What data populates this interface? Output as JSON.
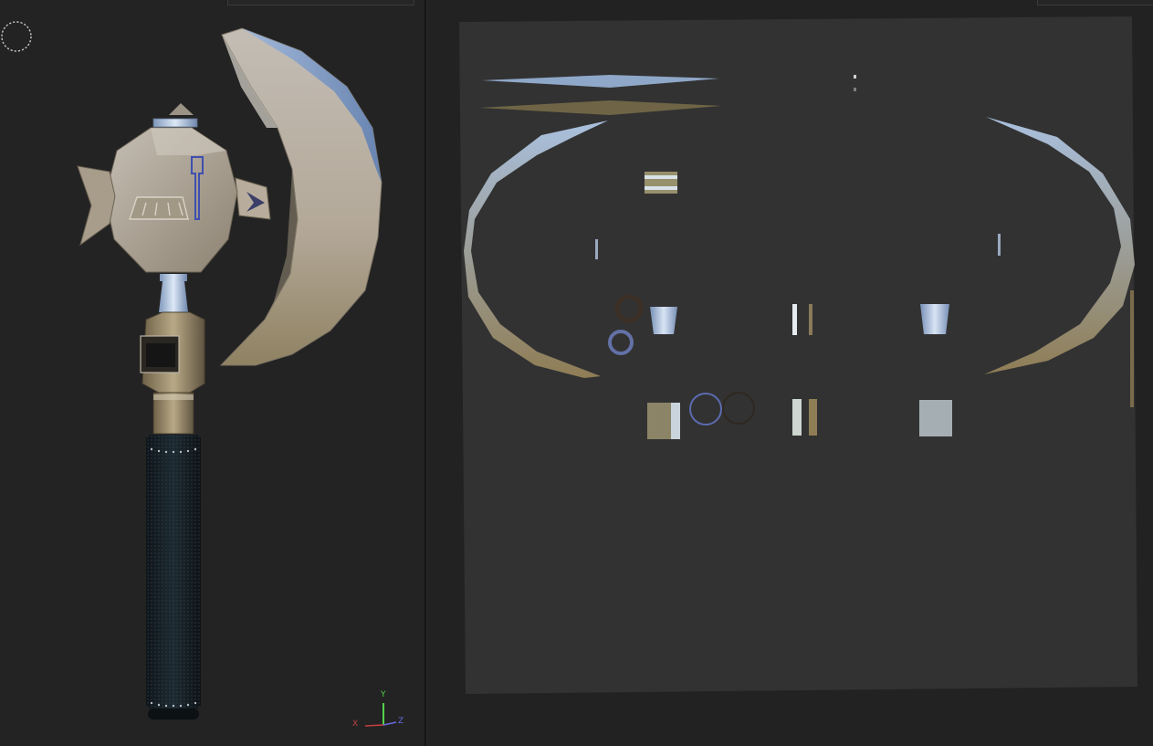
{
  "axis_gizmo": {
    "x_label": "X",
    "y_label": "Y",
    "z_label": "Z",
    "x_color": "#c44040",
    "y_color": "#52d24a",
    "z_color": "#6a6ae0"
  },
  "icons": {
    "viewport_gizmo": "dashed-circle-icon"
  },
  "colors": {
    "panel_bg": "#232323",
    "uv_canvas_bg": "#323232",
    "metal": "#b9ad9e",
    "steel_highlight": "#a9c4e8",
    "grip": "#141c22"
  }
}
